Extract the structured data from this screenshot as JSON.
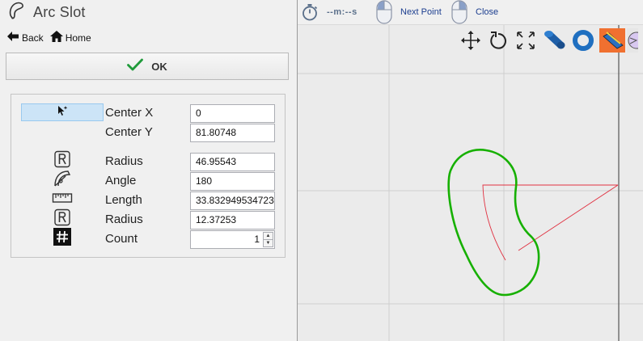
{
  "panel": {
    "title": "Arc Slot",
    "nav": {
      "back_label": "Back",
      "home_label": "Home"
    },
    "ok_label": "OK",
    "rows": [
      {
        "icon": "cursor-pick-icon",
        "label": "Center X",
        "value": "0"
      },
      {
        "icon": "",
        "label": "Center Y",
        "value": "81.80748"
      },
      {
        "icon": "radius-icon",
        "label": "Radius",
        "value": "46.95543"
      },
      {
        "icon": "angle-icon",
        "label": "Angle",
        "value": "180"
      },
      {
        "icon": "ruler-icon",
        "label": "Length",
        "value": "33.832949534723"
      },
      {
        "icon": "radius-icon",
        "label": "Radius",
        "value": "12.37253"
      },
      {
        "icon": "hash-icon",
        "label": "Count",
        "value": "1"
      }
    ]
  },
  "toolbar": {
    "timer": "--m:--s",
    "next_point_label": "Next Point",
    "close_label": "Close"
  },
  "viewport": {
    "tools": [
      "move-icon",
      "rotate-icon",
      "fit-view-icon",
      "solid-view-icon",
      "ring-view-icon",
      "wireframe-view-icon",
      "sphere-view-icon"
    ],
    "slot_color": "#16b000",
    "guide_color": "#e03040",
    "axis_color": "#555555",
    "grid_color": "#cfcfcf",
    "accent_color": "#f07030"
  }
}
